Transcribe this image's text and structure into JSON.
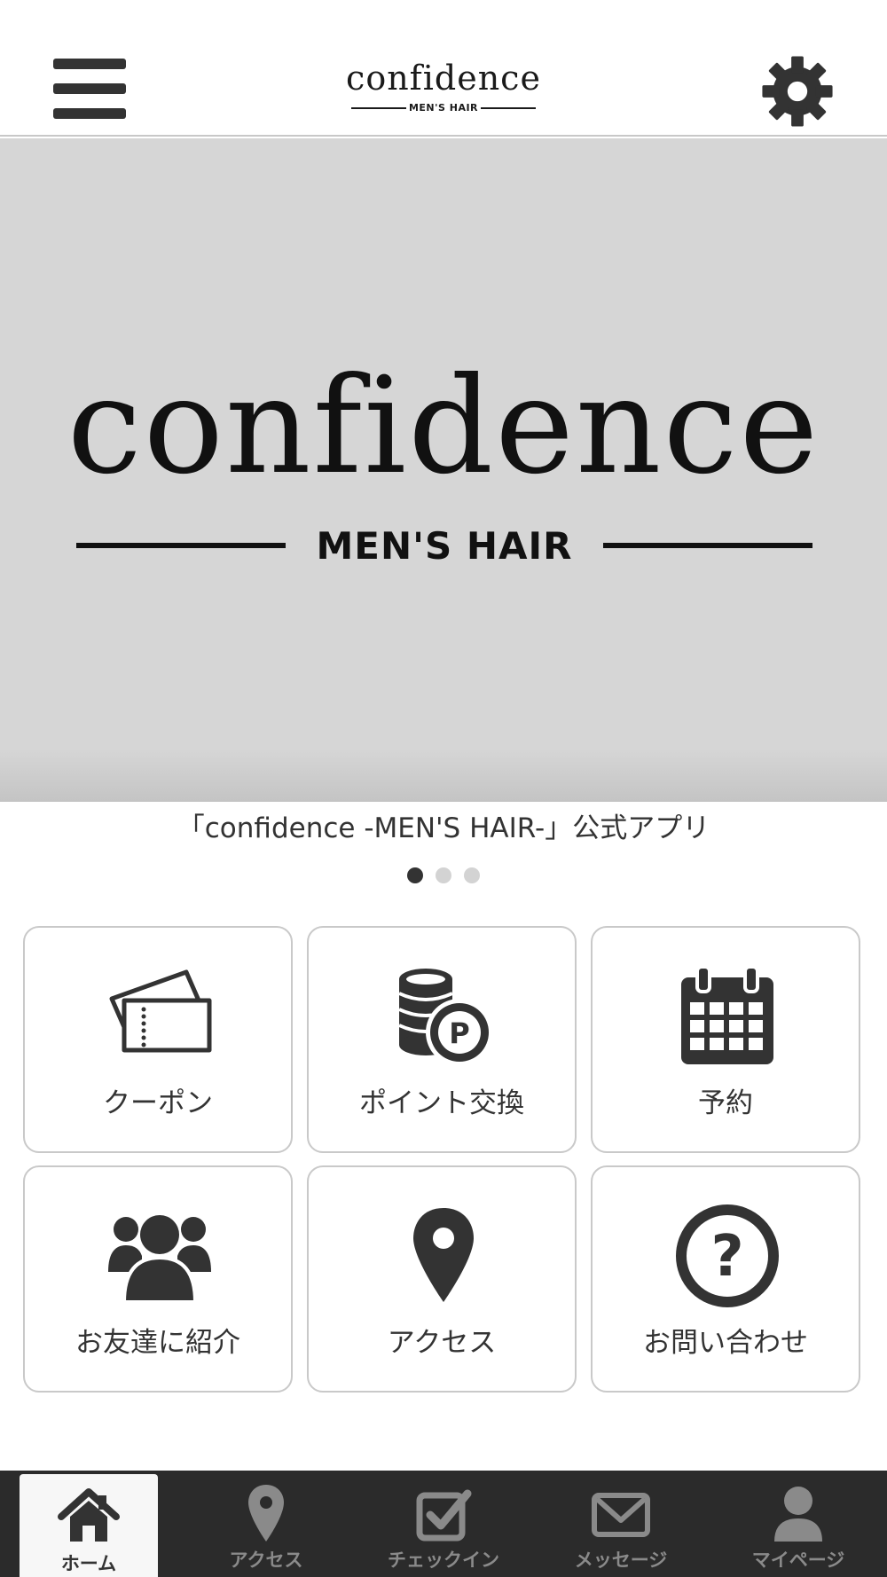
{
  "header": {
    "logo_word": "confidence",
    "logo_sub": "MEN'S HAIR"
  },
  "hero": {
    "logo_word": "confidence",
    "logo_sub": "MEN'S HAIR",
    "caption": "「confidence -MEN'S HAIR-」公式アプリ",
    "slides_total": 3,
    "active_slide": 1
  },
  "menu": {
    "items": [
      {
        "label": "クーポン",
        "icon": "coupon-icon"
      },
      {
        "label": "ポイント交換",
        "icon": "points-icon"
      },
      {
        "label": "予約",
        "icon": "calendar-icon"
      },
      {
        "label": "お友達に紹介",
        "icon": "friends-icon"
      },
      {
        "label": "アクセス",
        "icon": "map-pin-icon"
      },
      {
        "label": "お問い合わせ",
        "icon": "question-icon"
      }
    ]
  },
  "tabbar": {
    "items": [
      {
        "label": "ホーム",
        "icon": "home-icon",
        "active": true
      },
      {
        "label": "アクセス",
        "icon": "map-pin-icon",
        "active": false
      },
      {
        "label": "チェックイン",
        "icon": "checkin-icon",
        "active": false
      },
      {
        "label": "メッセージ",
        "icon": "mail-icon",
        "active": false
      },
      {
        "label": "マイページ",
        "icon": "user-icon",
        "active": false
      }
    ]
  },
  "colors": {
    "header_bg": "#ffffff",
    "hero_bg": "#d6d6d6",
    "icon_dark": "#333333",
    "tabbar_bg": "#2b2b2b",
    "tab_active_bg": "#f7f7f7",
    "tile_border": "#c9c9c9"
  }
}
